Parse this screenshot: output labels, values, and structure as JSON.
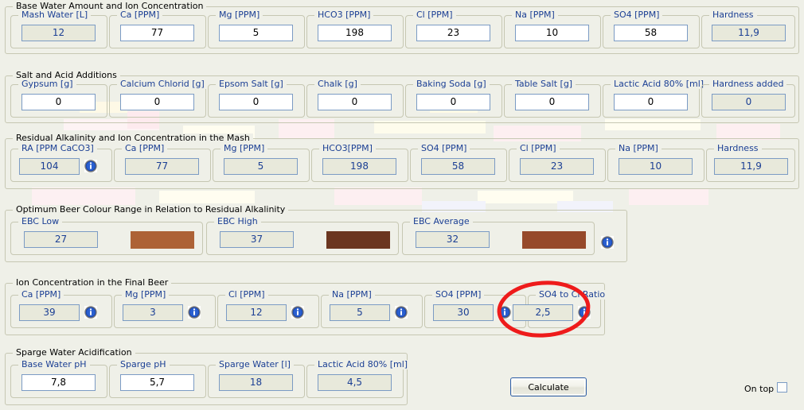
{
  "window": {
    "background": "#eff0e8",
    "label_color": "#1b3f94",
    "border_color": "#c6c7b2"
  },
  "sections": [
    {
      "id": "base-water",
      "title": "Base Water Amount and Ion Concentration",
      "fields": [
        {
          "label": "Mash Water [L]",
          "value": "12",
          "readonly": true,
          "info": false
        },
        {
          "label": "Ca [PPM]",
          "value": "77",
          "readonly": false,
          "info": false
        },
        {
          "label": "Mg [PPM]",
          "value": "5",
          "readonly": false,
          "info": false
        },
        {
          "label": "HCO3 [PPM]",
          "value": "198",
          "readonly": false,
          "info": false
        },
        {
          "label": "Cl [PPM]",
          "value": "23",
          "readonly": false,
          "info": false
        },
        {
          "label": "Na [PPM]",
          "value": "10",
          "readonly": false,
          "info": false
        },
        {
          "label": "SO4 [PPM]",
          "value": "58",
          "readonly": false,
          "info": false
        },
        {
          "label": "Hardness",
          "value": "11,9",
          "readonly": true,
          "info": false
        }
      ]
    },
    {
      "id": "salt-acid",
      "title": "Salt and Acid Additions",
      "fields": [
        {
          "label": "Gypsum [g]",
          "value": "0",
          "readonly": false,
          "info": false
        },
        {
          "label": "Calcium Chlorid [g]",
          "value": "0",
          "readonly": false,
          "info": false
        },
        {
          "label": "Epsom Salt [g]",
          "value": "0",
          "readonly": false,
          "info": false
        },
        {
          "label": "Chalk [g]",
          "value": "0",
          "readonly": false,
          "info": false
        },
        {
          "label": "Baking Soda [g]",
          "value": "0",
          "readonly": false,
          "info": false
        },
        {
          "label": "Table Salt [g]",
          "value": "0",
          "readonly": false,
          "info": false
        },
        {
          "label": "Lactic Acid 80% [ml]",
          "value": "0",
          "readonly": false,
          "info": false
        },
        {
          "label": "Hardness added",
          "value": "0",
          "readonly": true,
          "info": false
        }
      ]
    },
    {
      "id": "residual-alkalinity",
      "title": "Residual Alkalinity and Ion Concentration in the Mash",
      "fields": [
        {
          "label": "RA [PPM CaCO3]",
          "value": "104",
          "readonly": true,
          "info": true
        },
        {
          "label": "Ca [PPM]",
          "value": "77",
          "readonly": true,
          "info": false
        },
        {
          "label": "Mg [PPM]",
          "value": "5",
          "readonly": true,
          "info": false
        },
        {
          "label": "HCO3[PPM]",
          "value": "198",
          "readonly": true,
          "info": false
        },
        {
          "label": "SO4 [PPM]",
          "value": "58",
          "readonly": true,
          "info": false
        },
        {
          "label": "Cl [PPM]",
          "value": "23",
          "readonly": true,
          "info": false
        },
        {
          "label": "Na [PPM]",
          "value": "10",
          "readonly": true,
          "info": false
        },
        {
          "label": "Hardness",
          "value": "11,9",
          "readonly": true,
          "info": false
        }
      ]
    },
    {
      "id": "beer-colour",
      "title": "Optimum Beer Colour Range in Relation to Residual Alkalinity",
      "fields": [
        {
          "label": "EBC Low",
          "value": "27",
          "readonly": true,
          "swatch": "#ad6236",
          "info": false
        },
        {
          "label": "EBC High",
          "value": "37",
          "readonly": true,
          "swatch": "#6b3620",
          "info": false
        },
        {
          "label": "EBC Average",
          "value": "32",
          "readonly": true,
          "swatch": "#96492a",
          "info": true
        }
      ]
    },
    {
      "id": "final-beer",
      "title": "Ion Concentration in the Final Beer",
      "fields": [
        {
          "label": "Ca [PPM]",
          "value": "39",
          "readonly": true,
          "info": true
        },
        {
          "label": "Mg [PPM]",
          "value": "3",
          "readonly": true,
          "info": true
        },
        {
          "label": "Cl [PPM]",
          "value": "12",
          "readonly": true,
          "info": true
        },
        {
          "label": "Na [PPM]",
          "value": "5",
          "readonly": true,
          "info": true
        },
        {
          "label": "SO4 [PPM]",
          "value": "30",
          "readonly": true,
          "info": true
        },
        {
          "label": "SO4 to Cl Ratio",
          "value": "2,5",
          "readonly": true,
          "info": true
        }
      ]
    },
    {
      "id": "sparge-acidification",
      "title": "Sparge Water Acidification",
      "fields": [
        {
          "label": "Base Water pH",
          "value": "7,8",
          "readonly": false,
          "info": false
        },
        {
          "label": "Sparge pH",
          "value": "5,7",
          "readonly": false,
          "info": false
        },
        {
          "label": "Sparge Water [l]",
          "value": "18",
          "readonly": true,
          "info": false
        },
        {
          "label": "Lactic Acid 80% [ml]",
          "value": "4,5",
          "readonly": true,
          "info": false
        }
      ]
    }
  ],
  "actions": {
    "calculate_label": "Calculate",
    "on_top_label": "On top",
    "on_top_checked": false
  },
  "annotation": {
    "shape": "ellipse",
    "color": "#ee1b1b",
    "targets": "SO4 to Cl Ratio"
  },
  "icons": {
    "info": "info-icon"
  }
}
